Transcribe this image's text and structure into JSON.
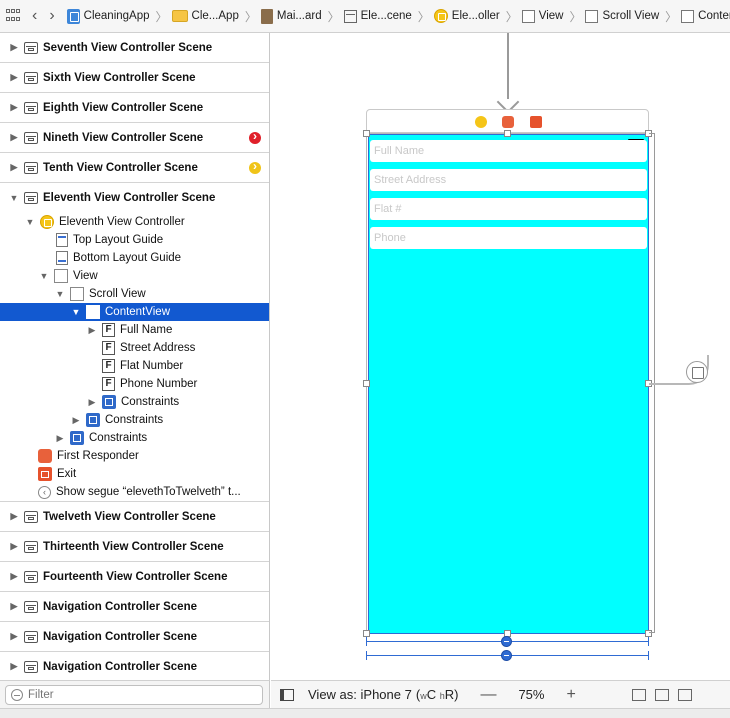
{
  "jumpbar": {
    "crumbs": [
      {
        "label": "CleaningApp",
        "icon": "project-icon"
      },
      {
        "label": "Cle...App",
        "icon": "folder-icon"
      },
      {
        "label": "Mai...ard",
        "icon": "storyboard-icon"
      },
      {
        "label": "Ele...cene",
        "icon": "scene-icon"
      },
      {
        "label": "Ele...oller",
        "icon": "view-controller-icon"
      },
      {
        "label": "View",
        "icon": "view-icon"
      },
      {
        "label": "Scroll View",
        "icon": "view-icon"
      },
      {
        "label": "ContentView",
        "icon": "view-icon"
      }
    ]
  },
  "navigator": {
    "scenes_top": [
      {
        "label": "Seventh View Controller Scene",
        "badge": ""
      },
      {
        "label": "Sixth View Controller Scene",
        "badge": ""
      },
      {
        "label": "Eighth View Controller Scene",
        "badge": ""
      },
      {
        "label": "Nineth View Controller Scene",
        "badge": "red"
      },
      {
        "label": "Tenth View Controller Scene",
        "badge": "yellow"
      }
    ],
    "expanded_scene": "Eleventh View Controller Scene",
    "tree": {
      "vc": "Eleventh View Controller",
      "top_guide": "Top Layout Guide",
      "bottom_guide": "Bottom Layout Guide",
      "view": "View",
      "scroll_view": "Scroll View",
      "content_view": "ContentView",
      "full_name": "Full Name",
      "street_address": "Street Address",
      "flat_number": "Flat Number",
      "phone_number": "Phone Number",
      "constraints_inner": "Constraints",
      "constraints_scroll": "Constraints",
      "constraints_view": "Constraints",
      "first_responder": "First Responder",
      "exit": "Exit",
      "segue": "Show segue “elevethToTwelveth” t..."
    },
    "scenes_bottom": [
      {
        "label": "Twelveth View Controller Scene"
      },
      {
        "label": "Thirteenth View Controller Scene"
      },
      {
        "label": "Fourteenth View Controller Scene"
      },
      {
        "label": "Navigation Controller Scene"
      },
      {
        "label": "Navigation Controller Scene"
      },
      {
        "label": "Navigation Controller Scene"
      }
    ]
  },
  "filter": {
    "placeholder": "Filter"
  },
  "canvas": {
    "fields": [
      {
        "placeholder": "Full Name"
      },
      {
        "placeholder": "Street Address"
      },
      {
        "placeholder": "Flat #"
      },
      {
        "placeholder": "Phone"
      }
    ],
    "content_color": "#00ffff"
  },
  "bottom_bar": {
    "view_as": "View as: iPhone 7",
    "size_class_open": "(",
    "size_class_w": "w",
    "size_class_c": "C",
    "size_class_h": "h",
    "size_class_r": "R",
    "size_class_close": ")",
    "zoom_out": "—",
    "zoom": "75%",
    "zoom_in": "+"
  },
  "colors": {
    "selection": "#1259d0",
    "cyan": "#00ffff",
    "constraint_blue": "#2f6bd3"
  }
}
